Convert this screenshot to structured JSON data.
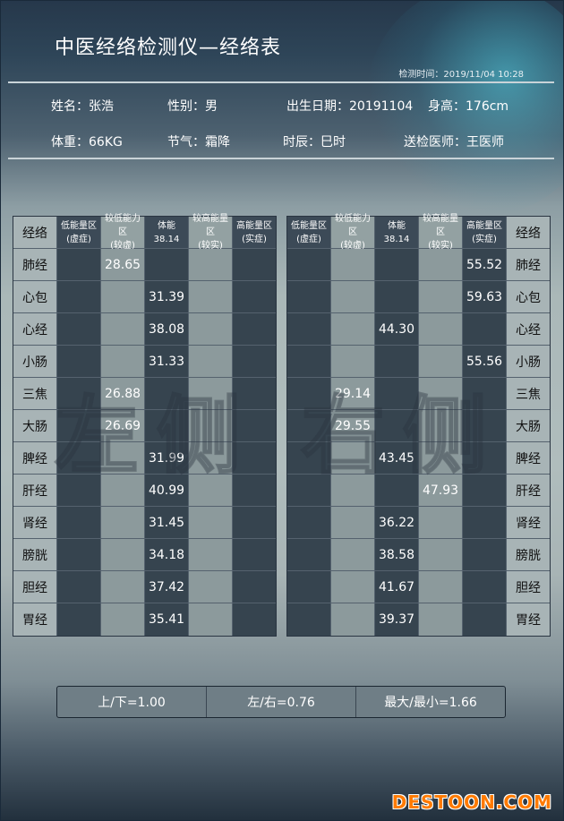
{
  "title": "中医经络检测仪—经络表",
  "test_time": "检测时间：2019/11/04 10:28",
  "patient": {
    "name_label": "姓名：",
    "name": "张浩",
    "gender_label": "性别：",
    "gender": "男",
    "birth_label": "出生日期：",
    "birth": "20191104",
    "height_label": "身高：",
    "height": "176cm",
    "weight_label": "体重：",
    "weight": "66KG",
    "solar_term_label": "节气：",
    "solar_term": "霜降",
    "hour_label": "时辰：",
    "hour": "巳时",
    "doctor_label": "送检医师：",
    "doctor": "王医师"
  },
  "left_table": {
    "watermark": "左侧",
    "headers": {
      "name": "经络",
      "c1": [
        "低能量区",
        "(虚症)"
      ],
      "c2": [
        "较低能力区",
        "(较虚)"
      ],
      "c3": [
        "体能",
        "38.14"
      ],
      "c4": [
        "较高能量区",
        "(较实)"
      ],
      "c5": [
        "高能量区",
        "(实症)"
      ]
    },
    "rows": [
      {
        "name": "肺经",
        "c1": "",
        "c2": "28.65",
        "c3": "",
        "c4": "",
        "c5": ""
      },
      {
        "name": "心包",
        "c1": "",
        "c2": "",
        "c3": "31.39",
        "c4": "",
        "c5": ""
      },
      {
        "name": "心经",
        "c1": "",
        "c2": "",
        "c3": "38.08",
        "c4": "",
        "c5": ""
      },
      {
        "name": "小肠",
        "c1": "",
        "c2": "",
        "c3": "31.33",
        "c4": "",
        "c5": ""
      },
      {
        "name": "三焦",
        "c1": "",
        "c2": "26.88",
        "c3": "",
        "c4": "",
        "c5": ""
      },
      {
        "name": "大肠",
        "c1": "",
        "c2": "26.69",
        "c3": "",
        "c4": "",
        "c5": ""
      },
      {
        "name": "脾经",
        "c1": "",
        "c2": "",
        "c3": "31.99",
        "c4": "",
        "c5": ""
      },
      {
        "name": "肝经",
        "c1": "",
        "c2": "",
        "c3": "40.99",
        "c4": "",
        "c5": ""
      },
      {
        "name": "肾经",
        "c1": "",
        "c2": "",
        "c3": "31.45",
        "c4": "",
        "c5": ""
      },
      {
        "name": "膀胱",
        "c1": "",
        "c2": "",
        "c3": "34.18",
        "c4": "",
        "c5": ""
      },
      {
        "name": "胆经",
        "c1": "",
        "c2": "",
        "c3": "37.42",
        "c4": "",
        "c5": ""
      },
      {
        "name": "胃经",
        "c1": "",
        "c2": "",
        "c3": "35.41",
        "c4": "",
        "c5": ""
      }
    ]
  },
  "right_table": {
    "watermark": "右侧",
    "headers": {
      "c1": [
        "低能量区",
        "(虚症)"
      ],
      "c2": [
        "较低能力区",
        "(较虚)"
      ],
      "c3": [
        "体能",
        "38.14"
      ],
      "c4": [
        "较高能量区",
        "(较实)"
      ],
      "c5": [
        "高能量区",
        "(实症)"
      ],
      "name": "经络"
    },
    "rows": [
      {
        "name": "肺经",
        "c1": "",
        "c2": "",
        "c3": "",
        "c4": "",
        "c5": "55.52"
      },
      {
        "name": "心包",
        "c1": "",
        "c2": "",
        "c3": "",
        "c4": "",
        "c5": "59.63"
      },
      {
        "name": "心经",
        "c1": "",
        "c2": "",
        "c3": "44.30",
        "c4": "",
        "c5": ""
      },
      {
        "name": "小肠",
        "c1": "",
        "c2": "",
        "c3": "",
        "c4": "",
        "c5": "55.56"
      },
      {
        "name": "三焦",
        "c1": "",
        "c2": "29.14",
        "c3": "",
        "c4": "",
        "c5": ""
      },
      {
        "name": "大肠",
        "c1": "",
        "c2": "29.55",
        "c3": "",
        "c4": "",
        "c5": ""
      },
      {
        "name": "脾经",
        "c1": "",
        "c2": "",
        "c3": "43.45",
        "c4": "",
        "c5": ""
      },
      {
        "name": "肝经",
        "c1": "",
        "c2": "",
        "c3": "",
        "c4": "47.93",
        "c5": ""
      },
      {
        "name": "肾经",
        "c1": "",
        "c2": "",
        "c3": "36.22",
        "c4": "",
        "c5": ""
      },
      {
        "name": "膀胱",
        "c1": "",
        "c2": "",
        "c3": "38.58",
        "c4": "",
        "c5": ""
      },
      {
        "name": "胆经",
        "c1": "",
        "c2": "",
        "c3": "41.67",
        "c4": "",
        "c5": ""
      },
      {
        "name": "胃经",
        "c1": "",
        "c2": "",
        "c3": "39.37",
        "c4": "",
        "c5": ""
      }
    ]
  },
  "summary": {
    "up_down": "上/下=1.00",
    "left_right": "左/右=0.76",
    "max_min": "最大/最小=1.66"
  },
  "logo": "DESTOON.COM"
}
